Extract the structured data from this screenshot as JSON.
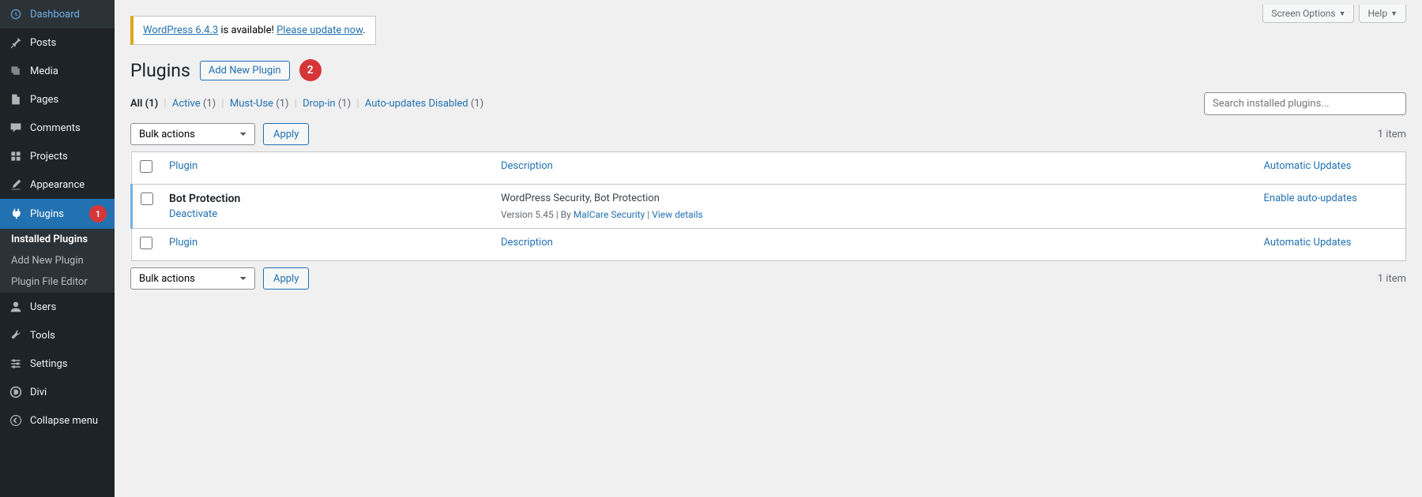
{
  "sidebar": {
    "dashboard": "Dashboard",
    "posts": "Posts",
    "media": "Media",
    "pages": "Pages",
    "comments": "Comments",
    "projects": "Projects",
    "appearance": "Appearance",
    "plugins": "Plugins",
    "plugins_badge": "1",
    "users": "Users",
    "tools": "Tools",
    "settings": "Settings",
    "divi": "Divi",
    "collapse": "Collapse menu",
    "submenu": {
      "installed": "Installed Plugins",
      "addnew": "Add New Plugin",
      "editor": "Plugin File Editor"
    }
  },
  "top": {
    "screen_options": "Screen Options",
    "help": "Help"
  },
  "notice": {
    "link1": "WordPress 6.4.3",
    "mid": " is available! ",
    "link2": "Please update now",
    "end": "."
  },
  "header": {
    "title": "Plugins",
    "addnew": "Add New Plugin",
    "badge": "2"
  },
  "filters": {
    "all": "All",
    "all_count": "(1)",
    "active": "Active",
    "active_count": "(1)",
    "mustuse": "Must-Use",
    "mustuse_count": "(1)",
    "dropin": "Drop-in",
    "dropin_count": "(1)",
    "auto": "Auto-updates Disabled",
    "auto_count": "(1)"
  },
  "search": {
    "placeholder": "Search installed plugins..."
  },
  "bulk": {
    "label": "Bulk actions",
    "apply": "Apply"
  },
  "count": "1 item",
  "table": {
    "col_plugin": "Plugin",
    "col_desc": "Description",
    "col_auto": "Automatic Updates"
  },
  "plugin": {
    "name": "Bot Protection",
    "deactivate": "Deactivate",
    "desc": "WordPress Security, Bot Protection",
    "version_pre": "Version 5.45 | By ",
    "author": "MalCare Security",
    "sep2": " | ",
    "view": "View details",
    "enable_auto": "Enable auto-updates"
  }
}
